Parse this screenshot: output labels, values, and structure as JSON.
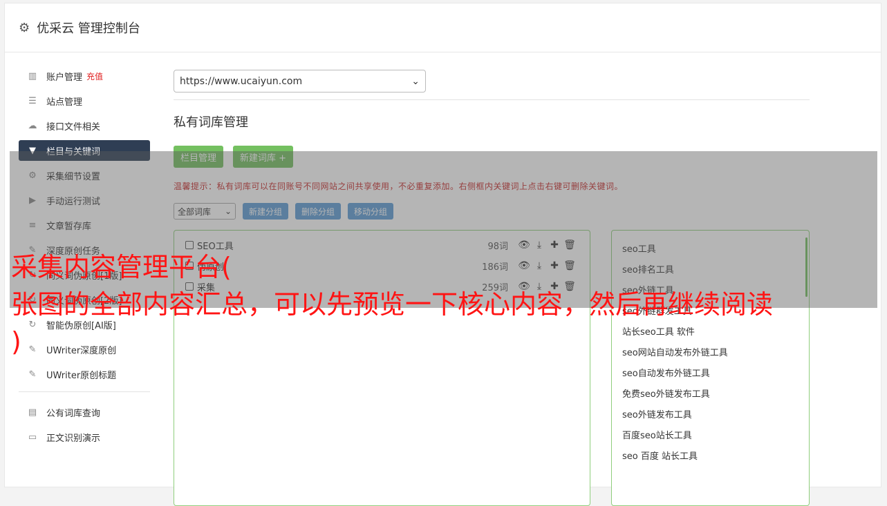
{
  "header": {
    "title": "优采云 管理控制台"
  },
  "sidebar": {
    "items": [
      {
        "icon": "bar-chart-icon",
        "label": "账户管理",
        "extra": "充值"
      },
      {
        "icon": "server-icon",
        "label": "站点管理"
      },
      {
        "icon": "cloud-upload-icon",
        "label": "接口文件相关"
      },
      {
        "icon": "filter-icon",
        "label": "栏目与关键词",
        "active": true
      },
      {
        "icon": "gears-icon",
        "label": "采集细节设置"
      },
      {
        "icon": "play-circle-icon",
        "label": "手动运行测试"
      },
      {
        "icon": "database-icon",
        "label": "文章暂存库"
      },
      {
        "icon": "edit-icon",
        "label": "深度原创任务"
      },
      {
        "icon": "refresh-icon",
        "label": "同义词伪原创[1版]"
      },
      {
        "icon": "refresh-icon",
        "label": "同义词伪原创[2版]"
      },
      {
        "icon": "refresh-icon",
        "label": "智能伪原创[AI版]"
      },
      {
        "icon": "edit-icon",
        "label": "UWriter深度原创"
      },
      {
        "icon": "edit-icon",
        "label": "UWriter原创标题"
      }
    ],
    "items2": [
      {
        "icon": "book-icon",
        "label": "公有词库查询"
      },
      {
        "icon": "monitor-icon",
        "label": "正文识别演示"
      }
    ]
  },
  "main": {
    "site_select": "https://www.ucaiyun.com",
    "title": "私有词库管理",
    "buttons": {
      "column_manage": "栏目管理",
      "new_library": "新建词库 +"
    },
    "tip": "温馨提示：私有词库可以在同账号不同网站之间共享使用，不必重复添加。右侧框内关键词上点击右键可删除关键词。",
    "group_select": "全部词库",
    "group_buttons": {
      "new": "新建分组",
      "delete": "删除分组",
      "move": "移动分组"
    },
    "libraries": [
      {
        "name": "SEO工具",
        "count": "98词"
      },
      {
        "name": "伪原创",
        "count": "186词"
      },
      {
        "name": "采集",
        "count": "259词"
      }
    ],
    "keywords": [
      "seo工具",
      "seo排名工具",
      "seo外链工具",
      "seo外链群发工具",
      "站长seo工具 软件",
      "seo网站自动发布外链工具",
      "seo自动发布外链工具",
      "免费seo外链发布工具",
      "seo外链发布工具",
      "百度seo站长工具",
      "seo 百度 站长工具"
    ]
  },
  "overlay": {
    "line1": "采集内容管理平台(",
    "line2": "张图的全部内容汇总，可以先预览一下核心内容，然后再继续阅读",
    "line3": ")"
  },
  "colors": {
    "active_bg": "#2f3e54",
    "green": "#74c060",
    "blue": "#5b9bd5",
    "warn": "#c62828",
    "overlay_text": "#ff1414"
  }
}
